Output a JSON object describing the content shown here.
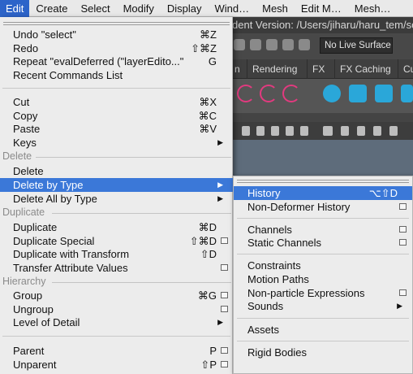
{
  "menubar": {
    "items": [
      "Edit",
      "Create",
      "Select",
      "Modify",
      "Display",
      "Wind…",
      "Mesh",
      "Edit M…",
      "Mesh…"
    ]
  },
  "background": {
    "version_text": "dent Version: /Users/jiharu/haru_tem/sc",
    "no_live_surface": "No Live Surface",
    "shelf_tabs": [
      "n",
      "Rendering",
      "FX",
      "FX Caching",
      "Cu"
    ]
  },
  "edit_menu": {
    "undo": {
      "label": "Undo \"select\"",
      "shortcut": "⌘Z"
    },
    "redo": {
      "label": "Redo",
      "shortcut": "⇧⌘Z"
    },
    "repeat": {
      "label": "Repeat \"evalDeferred (\"layerEdito...\"",
      "shortcut": "G"
    },
    "recent": {
      "label": "Recent Commands List"
    },
    "cut": {
      "label": "Cut",
      "shortcut": "⌘X"
    },
    "copy": {
      "label": "Copy",
      "shortcut": "⌘C"
    },
    "paste": {
      "label": "Paste",
      "shortcut": "⌘V"
    },
    "keys": {
      "label": "Keys"
    },
    "section_delete": "Delete",
    "delete": {
      "label": "Delete"
    },
    "delete_by_type": {
      "label": "Delete by Type"
    },
    "delete_all_by_type": {
      "label": "Delete All by Type"
    },
    "section_duplicate": "Duplicate",
    "duplicate": {
      "label": "Duplicate",
      "shortcut": "⌘D"
    },
    "duplicate_special": {
      "label": "Duplicate Special",
      "shortcut": "⇧⌘D"
    },
    "duplicate_transform": {
      "label": "Duplicate with Transform",
      "shortcut": "⇧D"
    },
    "transfer": {
      "label": "Transfer Attribute Values"
    },
    "section_hierarchy": "Hierarchy",
    "group": {
      "label": "Group",
      "shortcut": "⌘G"
    },
    "ungroup": {
      "label": "Ungroup"
    },
    "lod": {
      "label": "Level of Detail"
    },
    "parent": {
      "label": "Parent",
      "shortcut": "P"
    },
    "unparent": {
      "label": "Unparent",
      "shortcut": "⇧P"
    }
  },
  "submenu": {
    "history": {
      "label": "History",
      "shortcut": "⌥⇧D"
    },
    "non_deformer": {
      "label": "Non-Deformer History"
    },
    "channels": {
      "label": "Channels"
    },
    "static_channels": {
      "label": "Static Channels"
    },
    "constraints": {
      "label": "Constraints"
    },
    "motion_paths": {
      "label": "Motion Paths"
    },
    "non_particle": {
      "label": "Non-particle Expressions"
    },
    "sounds": {
      "label": "Sounds"
    },
    "assets": {
      "label": "Assets"
    },
    "rigid_bodies": {
      "label": "Rigid Bodies"
    }
  },
  "colors": {
    "highlight": "#3b78d8",
    "menubar_active": "#2d64c9",
    "menu_bg": "#ececec",
    "section_text": "#8b8b8b"
  }
}
